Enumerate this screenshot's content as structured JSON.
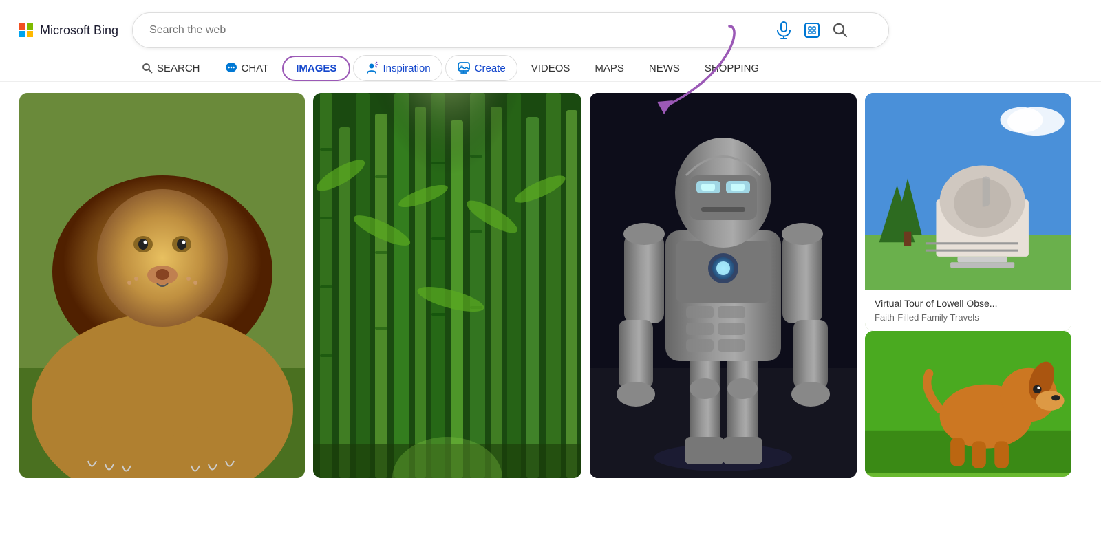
{
  "brand": {
    "logo_text": "Microsoft Bing",
    "ms_label": "Microsoft",
    "bing_label": "Bing"
  },
  "search": {
    "placeholder": "Search the web",
    "value": ""
  },
  "nav": {
    "items": [
      {
        "id": "search",
        "label": "SEARCH",
        "icon": "search-icon",
        "active": false,
        "styled": false
      },
      {
        "id": "chat",
        "label": "CHAT",
        "icon": "chat-icon",
        "active": false,
        "styled": false
      },
      {
        "id": "images",
        "label": "IMAGES",
        "icon": null,
        "active": true,
        "styled": "images"
      },
      {
        "id": "inspiration",
        "label": "Inspiration",
        "icon": "inspiration-icon",
        "active": false,
        "styled": "pill"
      },
      {
        "id": "create",
        "label": "Create",
        "icon": "create-icon",
        "active": false,
        "styled": "pill"
      },
      {
        "id": "videos",
        "label": "VIDEOS",
        "icon": null,
        "active": false,
        "styled": false
      },
      {
        "id": "maps",
        "label": "MAPS",
        "icon": null,
        "active": false,
        "styled": false
      },
      {
        "id": "news",
        "label": "NEWS",
        "icon": null,
        "active": false,
        "styled": false
      },
      {
        "id": "shopping",
        "label": "SHOPPING",
        "icon": null,
        "active": false,
        "styled": false
      }
    ]
  },
  "images": [
    {
      "id": "lion",
      "alt": "Lion resting on grass",
      "type": "lion"
    },
    {
      "id": "bamboo",
      "alt": "Bamboo forest path with light",
      "type": "bamboo"
    },
    {
      "id": "ironman",
      "alt": "Iron Man armor suit standing",
      "type": "ironman"
    },
    {
      "id": "observatory",
      "alt": "Dome building with trees and blue sky",
      "caption_line1": "Virtual Tour of Lowell Obse...",
      "caption_line2": "Faith-Filled Family Travels",
      "type": "observatory"
    },
    {
      "id": "dog",
      "alt": "Brown dog on green grass",
      "type": "dog"
    }
  ],
  "icons": {
    "mic": "🎤",
    "visual_search": "⊡",
    "search_glass": "🔍",
    "search_circle": "○",
    "chat_bubble": "💬"
  },
  "arrow": {
    "color": "#9b59b6",
    "pointing_to": "Create button"
  }
}
